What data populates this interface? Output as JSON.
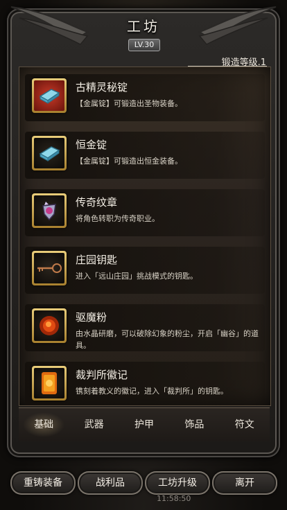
{
  "header": {
    "title": "工坊",
    "level": "LV.30",
    "forge_label": "锻造等级.1",
    "forge_progress": 1.0
  },
  "items": [
    {
      "name": "古精灵秘锭",
      "desc": "【金属锭】可锻造出圣物装备。",
      "icon": "ingot-icon",
      "frame_color": "#b03020"
    },
    {
      "name": "恒金锭",
      "desc": "【金属锭】可锻造出恒金装备。",
      "icon": "ingot-icon",
      "frame_color": "#c99a38"
    },
    {
      "name": "传奇纹章",
      "desc": "将角色转职为传奇职业。",
      "icon": "emblem-icon",
      "frame_color": "#c99a38"
    },
    {
      "name": "庄园钥匙",
      "desc": "进入「远山庄园」挑战模式的钥匙。",
      "icon": "key-icon",
      "frame_color": "#c99a38"
    },
    {
      "name": "驱魔粉",
      "desc": "由水晶研磨，可以破除幻象的粉尘，开启「幽谷」的道具。",
      "icon": "powder-icon",
      "frame_color": "#c99a38"
    },
    {
      "name": "裁判所徽记",
      "desc": "镌刻着教义的徽记，进入「裁判所」的钥匙。",
      "icon": "seal-icon",
      "frame_color": "#c99a38"
    }
  ],
  "tabs": [
    {
      "label": "基础",
      "active": true
    },
    {
      "label": "武器",
      "active": false
    },
    {
      "label": "护甲",
      "active": false
    },
    {
      "label": "饰品",
      "active": false
    },
    {
      "label": "符文",
      "active": false
    }
  ],
  "buttons": {
    "recast": "重铸装备",
    "loot": "战利品",
    "upgrade": "工坊升级",
    "leave": "离开"
  },
  "status": {
    "time": "11:58:50"
  }
}
